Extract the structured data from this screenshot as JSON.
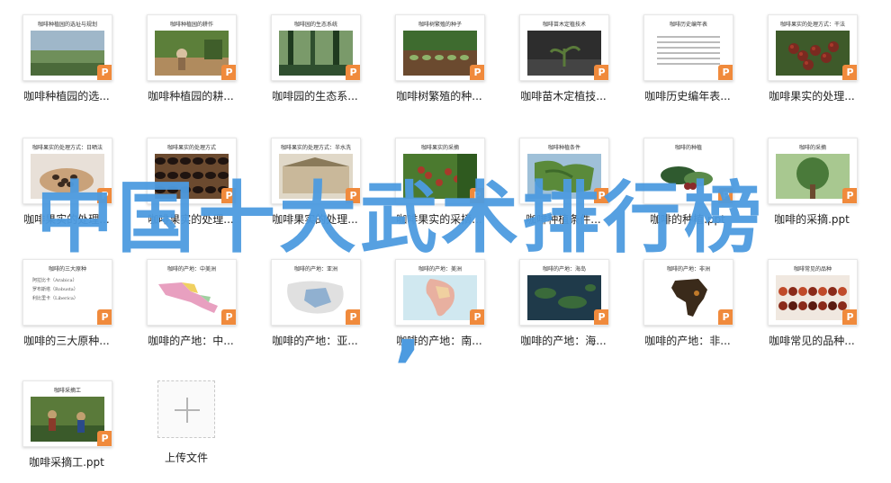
{
  "files": [
    {
      "thumb_title": "咖啡种植园的选址与规划",
      "caption": "咖啡种植园的选...",
      "pic": "landscape",
      "colors": [
        "#6f8f5a",
        "#9fb7c9",
        "#4b6a3a"
      ]
    },
    {
      "thumb_title": "咖啡种植园的耕作",
      "caption": "咖啡种植园的耕...",
      "pic": "farm",
      "colors": [
        "#5c7f3a",
        "#b08b5e",
        "#3f5e2a"
      ]
    },
    {
      "thumb_title": "咖啡园的生态系统",
      "caption": "咖啡园的生态系...",
      "pic": "forest",
      "colors": [
        "#2f4f2f",
        "#7a9a6a",
        "#1f3a1f"
      ]
    },
    {
      "thumb_title": "咖啡树繁殖的种子",
      "caption": "咖啡树繁殖的种...",
      "pic": "seedlings",
      "colors": [
        "#3e6b2f",
        "#8fb36a",
        "#6b4a2f"
      ]
    },
    {
      "thumb_title": "咖啡苗木定植技术",
      "caption": "咖啡苗木定植技...",
      "pic": "seedling-dark",
      "colors": [
        "#2d2d2d",
        "#5a7a3a",
        "#444"
      ]
    },
    {
      "thumb_title": "咖啡历史编年表",
      "caption": "咖啡历史编年表...",
      "pic": "document",
      "colors": [
        "#ffffff",
        "#bbbbbb",
        "#888"
      ]
    },
    {
      "thumb_title": "咖啡果实的处理方式：干法",
      "caption": "咖啡果实的处理...",
      "pic": "cherries",
      "colors": [
        "#7a2a20",
        "#3e5a2a",
        "#a83a2a"
      ]
    },
    {
      "thumb_title": "咖啡果实的处理方式：日晒法",
      "caption": "咖啡果实的处理...",
      "pic": "hands",
      "colors": [
        "#6b4a2f",
        "#c9a27a",
        "#3a2a1f"
      ]
    },
    {
      "thumb_title": "咖啡果实的处理方式",
      "caption": "咖啡果实的处理...",
      "pic": "beans",
      "colors": [
        "#3a2a1f",
        "#6b4a2f",
        "#1f1410"
      ]
    },
    {
      "thumb_title": "咖啡果实的处理方式：半水洗",
      "caption": "咖啡果实的处理...",
      "pic": "drying",
      "colors": [
        "#c9b89a",
        "#8a7a5a",
        "#e0d8c8"
      ]
    },
    {
      "thumb_title": "咖啡果实的采摘",
      "caption": "咖啡果实的采摘...",
      "pic": "picking",
      "colors": [
        "#4b7a2f",
        "#a83a2a",
        "#2f5a1f"
      ]
    },
    {
      "thumb_title": "咖啡种植条件",
      "caption": "咖啡种植条件...",
      "pic": "map-green",
      "colors": [
        "#5a8a3a",
        "#9fc0d8",
        "#3e6a2a"
      ]
    },
    {
      "thumb_title": "咖啡的种植",
      "caption": "咖啡的种植.ppt",
      "pic": "leaves",
      "colors": [
        "#2f5a2f",
        "#8a2a2a",
        "#5a8a4a"
      ]
    },
    {
      "thumb_title": "咖啡的采摘",
      "caption": "咖啡的采摘.ppt",
      "pic": "tree",
      "colors": [
        "#4a7a3a",
        "#a8c890",
        "#2f4a2a"
      ]
    },
    {
      "thumb_title": "咖啡的三大原种",
      "caption": "咖啡的三大原种...",
      "pic": "list",
      "colors": [
        "#ffffff",
        "#888",
        "#555"
      ],
      "list": [
        "阿拉比卡（Arabica）",
        "罗布斯塔（Robusta）",
        "利比里卡（Liberica）"
      ]
    },
    {
      "thumb_title": "咖啡的产地：中美洲",
      "caption": "咖啡的产地：中...",
      "pic": "map-central",
      "colors": [
        "#e8a0c0",
        "#f0d060",
        "#a0d0a0"
      ]
    },
    {
      "thumb_title": "咖啡的产地：亚洲",
      "caption": "咖啡的产地：亚...",
      "pic": "map-asia",
      "colors": [
        "#c8d8e8",
        "#e0e0e0",
        "#90b0d0"
      ]
    },
    {
      "thumb_title": "咖啡的产地：美洲",
      "caption": "咖啡的产地：南...",
      "pic": "map-south",
      "colors": [
        "#d0e8f0",
        "#e8b0a0",
        "#f0d0a0"
      ]
    },
    {
      "thumb_title": "咖啡的产地：海岛",
      "caption": "咖啡的产地：海...",
      "pic": "map-island",
      "colors": [
        "#1f3a4a",
        "#3a6a3a",
        "#0f2a3a"
      ]
    },
    {
      "thumb_title": "咖啡的产地：非洲",
      "caption": "咖啡的产地：非...",
      "pic": "africa",
      "colors": [
        "#ffffff",
        "#3a2a1a",
        "#c07a2a"
      ]
    },
    {
      "thumb_title": "咖啡常见的品种",
      "caption": "咖啡常见的品种...",
      "pic": "varieties",
      "colors": [
        "#8a2a1a",
        "#c04a2a",
        "#5a1a10"
      ]
    },
    {
      "thumb_title": "咖啡采摘工",
      "caption": "咖啡采摘工.ppt",
      "pic": "workers",
      "colors": [
        "#5a7a3a",
        "#c0a070",
        "#3a5a2a"
      ]
    }
  ],
  "upload": {
    "label": "上传文件"
  },
  "overlay": {
    "watermark": "中国十大武术排行榜",
    "comma": ","
  },
  "badge_letter": "P"
}
